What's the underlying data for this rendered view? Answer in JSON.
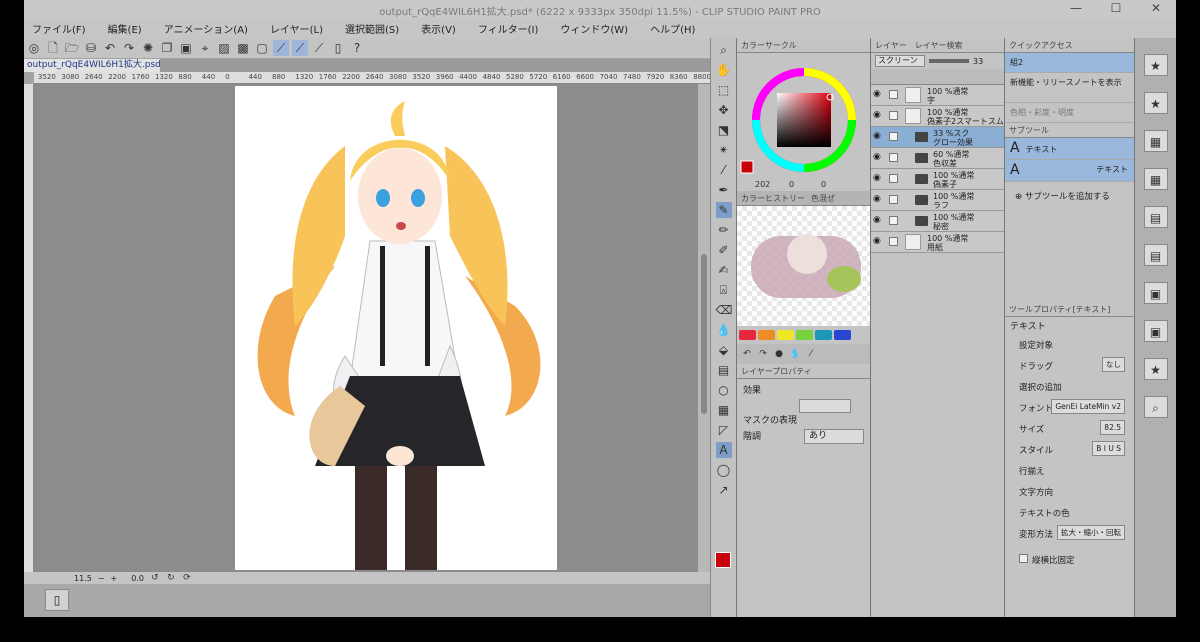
{
  "titlebar": {
    "title": "output_rQqE4WIL6H1拡大.psd* (6222 x 9333px 350dpi 11.5%)  - CLIP STUDIO PAINT PRO",
    "minimize": "—",
    "maximize": "☐",
    "close": "✕"
  },
  "menu": [
    "ファイル(F)",
    "編集(E)",
    "アニメーション(A)",
    "レイヤー(L)",
    "選択範囲(S)",
    "表示(V)",
    "フィルター(I)",
    "ウィンドウ(W)",
    "ヘルプ(H)"
  ],
  "doc_tab": {
    "label": "output_rQqE4WIL6H1拡大.psd*",
    "close": "×"
  },
  "ruler_ticks": [
    "3520",
    "3080",
    "2640",
    "2200",
    "1760",
    "1320",
    "880",
    "440",
    "0",
    "440",
    "880",
    "1320",
    "1760",
    "2200",
    "2640",
    "3080",
    "3520",
    "3960",
    "4400",
    "4840",
    "5280",
    "5720",
    "6160",
    "6600",
    "7040",
    "7480",
    "7920",
    "8360",
    "8800"
  ],
  "navigator": {
    "zoom": "11.5",
    "minus": "−",
    "plus": "+",
    "angle": "0.0"
  },
  "color_panel": {
    "tab_active": "カラーサークル",
    "tab_history": "カラーヒストリー",
    "tab_set": "色混ぜ",
    "values": {
      "r": "202",
      "g": "0",
      "b": "0"
    },
    "main_color": "#c8000a"
  },
  "palette": [
    {
      "name": "red-swatch",
      "color": "#e8283c"
    },
    {
      "name": "orange-swatch",
      "color": "#f08c28"
    },
    {
      "name": "yellow-swatch",
      "color": "#f0e628"
    },
    {
      "name": "green-swatch",
      "color": "#78d23c"
    },
    {
      "name": "teal-swatch",
      "color": "#1e96b4"
    },
    {
      "name": "blue-swatch",
      "color": "#2846d2"
    }
  ],
  "layer_property": {
    "tab": "レイヤープロパティ",
    "effect_label": "効果",
    "mask_label": "マスクの表現",
    "tone_label": "階調",
    "tone_value": "あり"
  },
  "layer_panel": {
    "tab": "レイヤー",
    "tab_search": "レイヤー検索",
    "blend": "スクリーン",
    "opacity": "33"
  },
  "layers": [
    {
      "line1": "100 %通常",
      "line2": "字",
      "type": "raster",
      "selected": false
    },
    {
      "line1": "100 %通常",
      "line2": "偽素子2スマートスム",
      "type": "raster",
      "selected": false
    },
    {
      "line1": "33 %スク",
      "line2": "グロー効果",
      "type": "folder",
      "selected": true
    },
    {
      "line1": "60 %通常",
      "line2": "色収差",
      "type": "folder",
      "selected": false
    },
    {
      "line1": "100 %通常",
      "line2": "偽素子",
      "type": "folder",
      "selected": false
    },
    {
      "line1": "100 %通常",
      "line2": "ラフ",
      "type": "folder",
      "selected": false
    },
    {
      "line1": "100 %通常",
      "line2": "秘密",
      "type": "folder",
      "selected": false
    },
    {
      "line1": "100 %通常",
      "line2": "用紙",
      "type": "paper",
      "selected": false
    }
  ],
  "quick_access": {
    "tab": "クイックアクセス",
    "set": "組2",
    "items": [
      "新機能・リリースノートを表示",
      "色相・彩度・明度"
    ]
  },
  "sub_tool": {
    "tab": "サブツール",
    "items": [
      "テキスト",
      "テキスト"
    ],
    "add": "サブツールを追加する"
  },
  "tool_property": {
    "tab": "ツールプロパティ[テキスト]",
    "title": "テキスト",
    "rows": [
      {
        "label": "設定対象",
        "value": ""
      },
      {
        "label": "ドラッグ",
        "value": "なし"
      },
      {
        "label": "選択の追加",
        "value": ""
      },
      {
        "label": "フォント",
        "value": "GenEi LateMin v2"
      },
      {
        "label": "サイズ",
        "value": "82.5"
      },
      {
        "label": "スタイル",
        "value": "B I U S"
      },
      {
        "label": "行揃え",
        "value": ""
      },
      {
        "label": "文字方向",
        "value": ""
      },
      {
        "label": "テキストの色",
        "value": ""
      },
      {
        "label": "変形方法",
        "value": "拡大・縮小・回転"
      }
    ],
    "checkbox": "縦横比固定"
  }
}
